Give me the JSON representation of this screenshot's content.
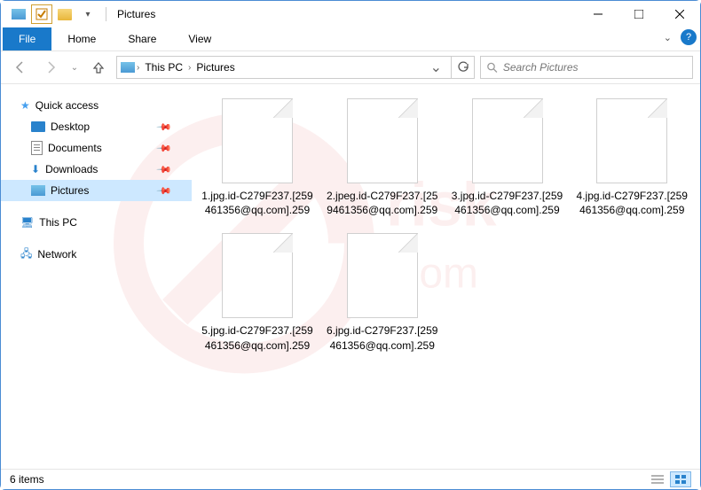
{
  "window": {
    "title": "Pictures"
  },
  "ribbon": {
    "file": "File",
    "tabs": [
      "Home",
      "Share",
      "View"
    ]
  },
  "breadcrumb": {
    "items": [
      "This PC",
      "Pictures"
    ]
  },
  "search": {
    "placeholder": "Search Pictures"
  },
  "nav": {
    "quick_access": "Quick access",
    "items": [
      {
        "label": "Desktop",
        "pinned": true
      },
      {
        "label": "Documents",
        "pinned": true
      },
      {
        "label": "Downloads",
        "pinned": true
      },
      {
        "label": "Pictures",
        "pinned": true,
        "selected": true
      }
    ],
    "this_pc": "This PC",
    "network": "Network"
  },
  "files": [
    {
      "name": "1.jpg.id-C279F237.[259461356@qq.com].259"
    },
    {
      "name": "2.jpeg.id-C279F237.[259461356@qq.com].259"
    },
    {
      "name": "3.jpg.id-C279F237.[259461356@qq.com].259"
    },
    {
      "name": "4.jpg.id-C279F237.[259461356@qq.com].259"
    },
    {
      "name": "5.jpg.id-C279F237.[259461356@qq.com].259"
    },
    {
      "name": "6.jpg.id-C279F237.[259461356@qq.com].259"
    }
  ],
  "status": {
    "count": "6 items"
  }
}
